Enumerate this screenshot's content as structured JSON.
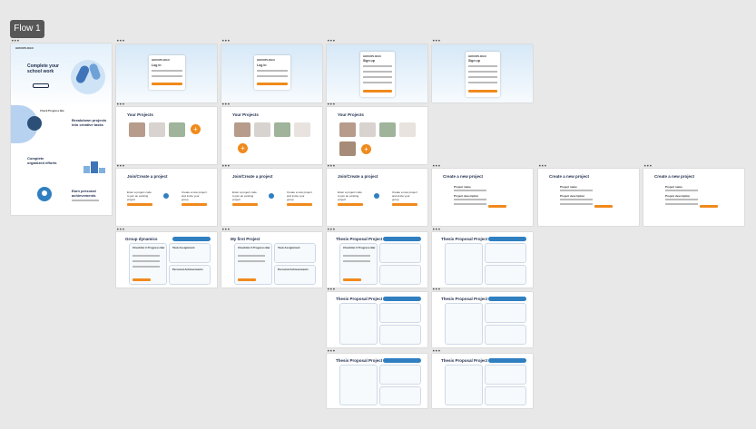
{
  "flow": {
    "label": "Flow 1"
  },
  "landing": {
    "logo": "GROUPLOGO",
    "hero_title": "Complete your school work",
    "feature1": "Breakdown projects into creative tasks",
    "feature2": "Complete organized efforts",
    "feature3": "Earn personal achievements",
    "badge_text": "Check Progress Bar"
  },
  "auth": {
    "title": "Log in",
    "signup": "Sign up",
    "brand": "GROUPLOGO"
  },
  "projects": {
    "title": "Your Projects"
  },
  "join": {
    "title": "Join/Create a project",
    "join_text": "Enter a project code to join an existing project",
    "create_text": "Create a new project and invite your group"
  },
  "create": {
    "title": "Create a new project",
    "name_label": "Project name",
    "desc_label": "Project description"
  },
  "dyn": {
    "title": "Group dynamics",
    "first_project": "My first Project",
    "thesis": "Thesis Proposal Project",
    "checklist": "Checklist // Progress Bar",
    "task_assign": "Task Assignment",
    "personal": "Personal Achievements",
    "pill_label": "Group code/ join a project"
  },
  "colors": {
    "accent": "#f08a1c",
    "blue": "#2f7fc1",
    "dark": "#1d2b4a"
  }
}
